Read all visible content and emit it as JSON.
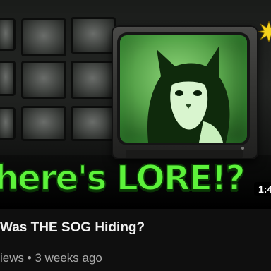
{
  "thumbnail": {
    "overlay_text": "here's LORE!?",
    "duration": "1:4"
  },
  "video": {
    "title": "Was THE SOG Hiding?",
    "meta": "iews • 3 weeks ago"
  },
  "colors": {
    "overlay_text": "#5cf23a",
    "background": "#0f0f0f",
    "title": "#f1f1f1",
    "meta": "#aaaaaa",
    "badge": "#f5d21c"
  },
  "icons": {
    "badge": "sun-badge-icon"
  }
}
